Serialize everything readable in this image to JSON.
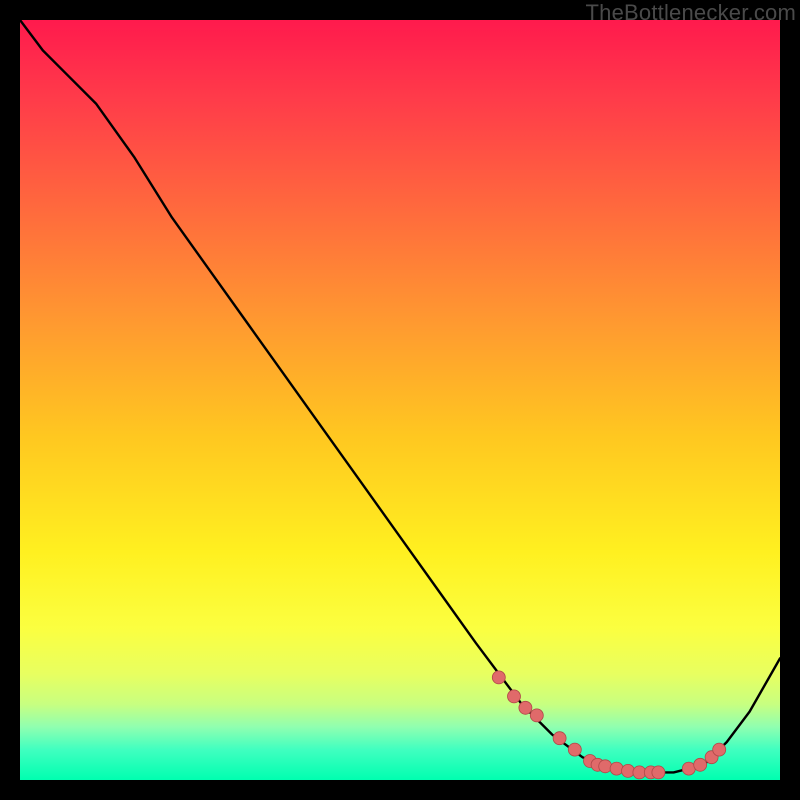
{
  "attribution": "TheBottlenecker.com",
  "chart_data": {
    "type": "line",
    "title": "",
    "xlabel": "",
    "ylabel": "",
    "xlim": [
      0,
      100
    ],
    "ylim": [
      0,
      100
    ],
    "series": [
      {
        "name": "curve",
        "x": [
          0,
          3,
          6,
          10,
          15,
          20,
          25,
          30,
          35,
          40,
          45,
          50,
          55,
          60,
          63,
          66,
          70,
          74,
          78,
          82,
          86,
          90,
          93,
          96,
          100
        ],
        "y": [
          100,
          96,
          93,
          89,
          82,
          74,
          67,
          60,
          53,
          46,
          39,
          32,
          25,
          18,
          14,
          10,
          6,
          3,
          1.5,
          1,
          1,
          2,
          5,
          9,
          16
        ]
      }
    ],
    "markers": {
      "name": "highlight-points",
      "x": [
        63,
        65,
        66.5,
        68,
        71,
        73,
        75,
        76,
        77,
        78.5,
        80,
        81.5,
        83,
        84,
        88,
        89.5,
        91,
        92
      ],
      "y": [
        13.5,
        11,
        9.5,
        8.5,
        5.5,
        4,
        2.5,
        2,
        1.8,
        1.5,
        1.2,
        1,
        1,
        1,
        1.5,
        2,
        3,
        4
      ]
    },
    "gradient_bands": "vertical thermal (red→yellow→green) implying lower y = better"
  }
}
